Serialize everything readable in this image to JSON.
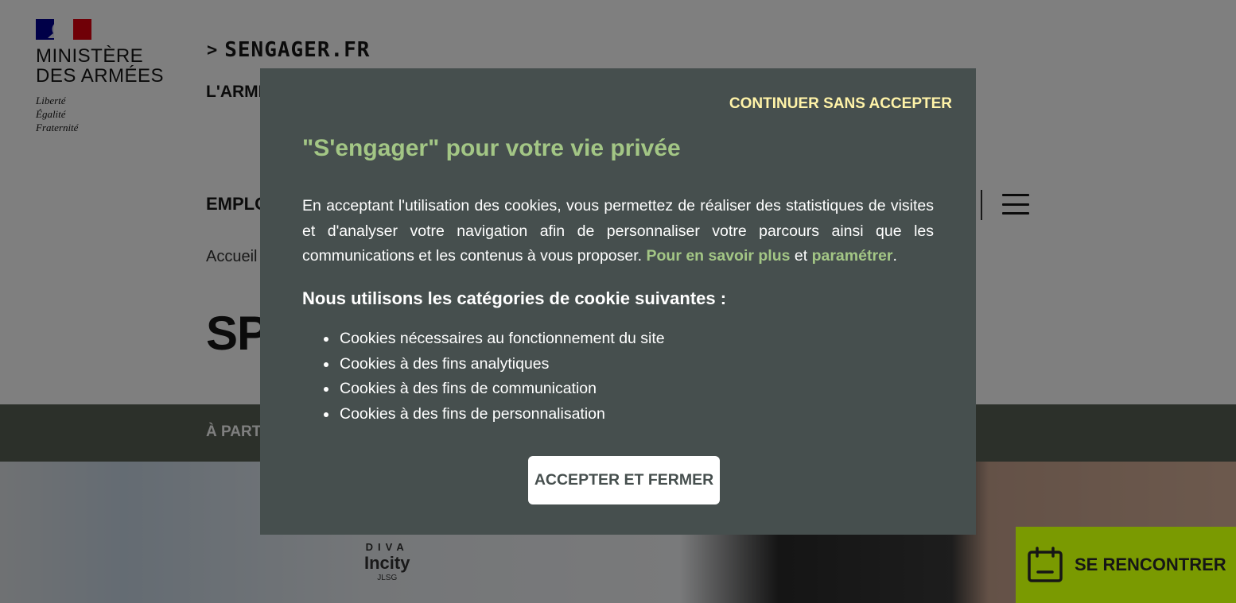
{
  "header": {
    "ministry_line1": "MINISTÈRE",
    "ministry_line2": "DES ARMÉES",
    "motto_1": "Liberté",
    "motto_2": "Égalité",
    "motto_3": "Fraternité",
    "brand": "SENGAGER.FR",
    "brand_arrow": ">",
    "armee_partial": "L'ARMÉ",
    "nav_partial": "EMPLO",
    "breadcrumb_partial": "Accueil",
    "title_partial": "SPÉ",
    "band_partial": "À PARTI"
  },
  "hero": {
    "sign_diva": "DIVA",
    "sign_incity": "Incity",
    "sign_jlsg": "JLSG"
  },
  "modal": {
    "skip_label": "CONTINUER SANS ACCEPTER",
    "title": "\"S'engager\" pour votre vie privée",
    "intro_text": "En acceptant l'utilisation des cookies, vous permettez de réaliser des statistiques de visites et d'analyser votre navigation afin de personnaliser votre parcours ainsi que les communications et les contenus à vous proposer. ",
    "learn_more_link": "Pour en savoir plus",
    "and_word": " et ",
    "settings_link": "paramétrer",
    "period": ".",
    "categories_title": "Nous utilisons les catégories de cookie suivantes :",
    "categories": [
      "Cookies nécessaires au fonctionnement du site",
      "Cookies à des fins analytiques",
      "Cookies à des fins de communication",
      "Cookies à des fins de personnalisation"
    ],
    "accept_label": "ACCEPTER ET FERMER"
  },
  "cta": {
    "label": "SE RENCONTRER",
    "icon": "calendar-icon"
  },
  "colors": {
    "modal_bg": "#464f4e",
    "accent_green": "#a3c685",
    "skip_yellow": "#fff3a8",
    "cta_bg": "#7a9a01",
    "band_bg": "#596055"
  }
}
